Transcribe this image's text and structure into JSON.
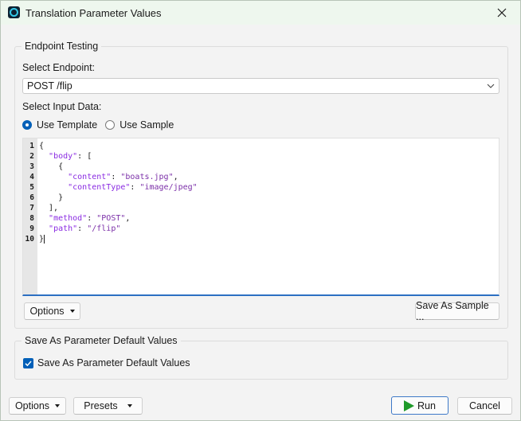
{
  "window": {
    "title": "Translation Parameter Values"
  },
  "endpoint_testing": {
    "legend": "Endpoint Testing",
    "select_endpoint_label": "Select Endpoint:",
    "endpoint_value": "POST /flip",
    "select_input_label": "Select Input Data:",
    "radio_template": "Use Template",
    "radio_sample": "Use Sample",
    "selected_input": "Use Template",
    "options_label": "Options",
    "save_sample_label": "Save As Sample ..."
  },
  "editor": {
    "lines": [
      {
        "n": "1",
        "tokens": [
          {
            "t": "{",
            "c": ""
          }
        ]
      },
      {
        "n": "2",
        "tokens": [
          {
            "t": "  ",
            "c": ""
          },
          {
            "t": "\"body\"",
            "c": "k"
          },
          {
            "t": ": [",
            "c": ""
          }
        ]
      },
      {
        "n": "3",
        "tokens": [
          {
            "t": "    {",
            "c": ""
          }
        ]
      },
      {
        "n": "4",
        "tokens": [
          {
            "t": "      ",
            "c": ""
          },
          {
            "t": "\"content\"",
            "c": "k"
          },
          {
            "t": ": ",
            "c": ""
          },
          {
            "t": "\"boats.jpg\"",
            "c": "p"
          },
          {
            "t": ",",
            "c": ""
          }
        ]
      },
      {
        "n": "5",
        "tokens": [
          {
            "t": "      ",
            "c": ""
          },
          {
            "t": "\"contentType\"",
            "c": "k"
          },
          {
            "t": ": ",
            "c": ""
          },
          {
            "t": "\"image/jpeg\"",
            "c": "p"
          }
        ]
      },
      {
        "n": "6",
        "tokens": [
          {
            "t": "    }",
            "c": ""
          }
        ]
      },
      {
        "n": "7",
        "tokens": [
          {
            "t": "  ],",
            "c": ""
          }
        ]
      },
      {
        "n": "8",
        "tokens": [
          {
            "t": "  ",
            "c": ""
          },
          {
            "t": "\"method\"",
            "c": "k"
          },
          {
            "t": ": ",
            "c": ""
          },
          {
            "t": "\"POST\"",
            "c": "p"
          },
          {
            "t": ",",
            "c": ""
          }
        ]
      },
      {
        "n": "9",
        "tokens": [
          {
            "t": "  ",
            "c": ""
          },
          {
            "t": "\"path\"",
            "c": "k"
          },
          {
            "t": ": ",
            "c": ""
          },
          {
            "t": "\"/flip\"",
            "c": "p"
          }
        ]
      },
      {
        "n": "10",
        "tokens": [
          {
            "t": "}",
            "c": ""
          }
        ]
      }
    ]
  },
  "defaults": {
    "legend": "Save As Parameter Default Values",
    "checkbox_label": "Save As Parameter Default Values",
    "checked": true
  },
  "footer": {
    "options_label": "Options",
    "presets_label": "Presets",
    "run_label": "Run",
    "cancel_label": "Cancel"
  },
  "colors": {
    "accent": "#005fb8",
    "run_icon": "#1f9a2a",
    "titlebar": "#eef7ee"
  },
  "icons": {
    "app": "app-icon",
    "close": "close-icon",
    "run": "play-icon"
  }
}
